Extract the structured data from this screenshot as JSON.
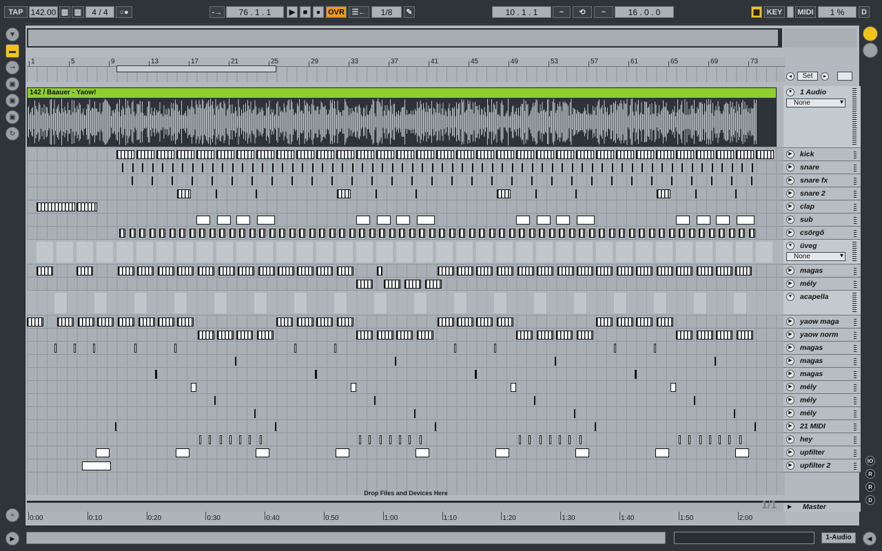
{
  "transport": {
    "tap": "TAP",
    "tempo": "142.00",
    "signature": "4 / 4",
    "position": "76 .  1 .  1",
    "ovr": "OVR",
    "quant": "1/8",
    "loop_start": "10 .  1 .  1",
    "loop_length": "16 .  0 .  0",
    "key": "KEY",
    "midi": "MIDI",
    "cpu": "1 %",
    "d": "D"
  },
  "ruler": {
    "bars": [
      "1",
      "5",
      "9",
      "13",
      "17",
      "21",
      "25",
      "29",
      "33",
      "37",
      "41",
      "45",
      "49",
      "53",
      "57",
      "61",
      "65",
      "69",
      "73"
    ]
  },
  "timeline": {
    "times": [
      "0:00",
      "0:10",
      "0:20",
      "0:30",
      "0:40",
      "0:50",
      "1:00",
      "1:10",
      "1:20",
      "1:30",
      "1:40",
      "1:50",
      "2:00"
    ]
  },
  "set_button": "Set",
  "audio_clip_name": "142 / Baauer - Yaow!",
  "tracks": [
    {
      "name": "1 Audio",
      "select": "None",
      "group": true
    },
    {
      "name": "kick"
    },
    {
      "name": "snare"
    },
    {
      "name": "snare fx"
    },
    {
      "name": "snare 2"
    },
    {
      "name": "clap"
    },
    {
      "name": "sub"
    },
    {
      "name": "csörgő"
    },
    {
      "name": "üveg",
      "select": "None",
      "group": true
    },
    {
      "name": "magas"
    },
    {
      "name": "mély"
    },
    {
      "name": "acapella",
      "group": true
    },
    {
      "name": "yaow maga"
    },
    {
      "name": "yaow norm"
    },
    {
      "name": "magas"
    },
    {
      "name": "magas"
    },
    {
      "name": "magas"
    },
    {
      "name": "mély"
    },
    {
      "name": "mély"
    },
    {
      "name": "mély"
    },
    {
      "name": "21 MIDI"
    },
    {
      "name": "hey"
    },
    {
      "name": "upfilter"
    },
    {
      "name": "upfilter 2"
    }
  ],
  "drop_zone": "Drop Files and Devices Here",
  "master": "Master",
  "page_counter": "1/1",
  "status": {
    "track_label": "1-Audio"
  },
  "colors": {
    "accent_yellow": "#f2c21b",
    "clip_green": "#8fce2f",
    "ovr_orange": "#f29a1b"
  },
  "icons": {
    "left_strip": [
      "browser-toggle-icon",
      "session-view-icon",
      "plugin-icon",
      "folder-icon",
      "folder-icon",
      "folder-icon",
      "refresh-icon"
    ],
    "right_strip": [
      "arrangement-view-icon",
      "mixer-view-icon"
    ]
  }
}
